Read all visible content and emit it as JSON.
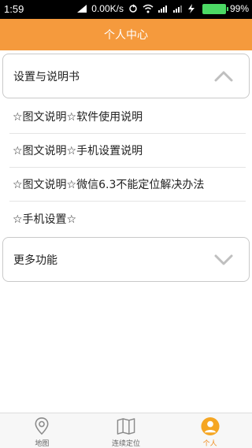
{
  "status_bar": {
    "time": "1:59",
    "net_speed": "0.00K/s",
    "battery": "99%"
  },
  "header": {
    "title": "个人中心"
  },
  "sections": [
    {
      "label": "设置与说明书",
      "expanded": true,
      "items": [
        "☆图文说明☆软件使用说明",
        "☆图文说明☆手机设置说明",
        "☆图文说明☆微信6.3不能定位解决办法",
        "☆手机设置☆"
      ]
    },
    {
      "label": "更多功能",
      "expanded": false
    }
  ],
  "tabs": [
    {
      "label": "地图",
      "icon": "map-pin-icon",
      "active": false
    },
    {
      "label": "连续定位",
      "icon": "folded-map-icon",
      "active": false
    },
    {
      "label": "个人",
      "icon": "person-icon",
      "active": true
    }
  ],
  "colors": {
    "accent": "#f59a3d",
    "active_tab": "#f08c1e",
    "battery": "#4cd964"
  }
}
